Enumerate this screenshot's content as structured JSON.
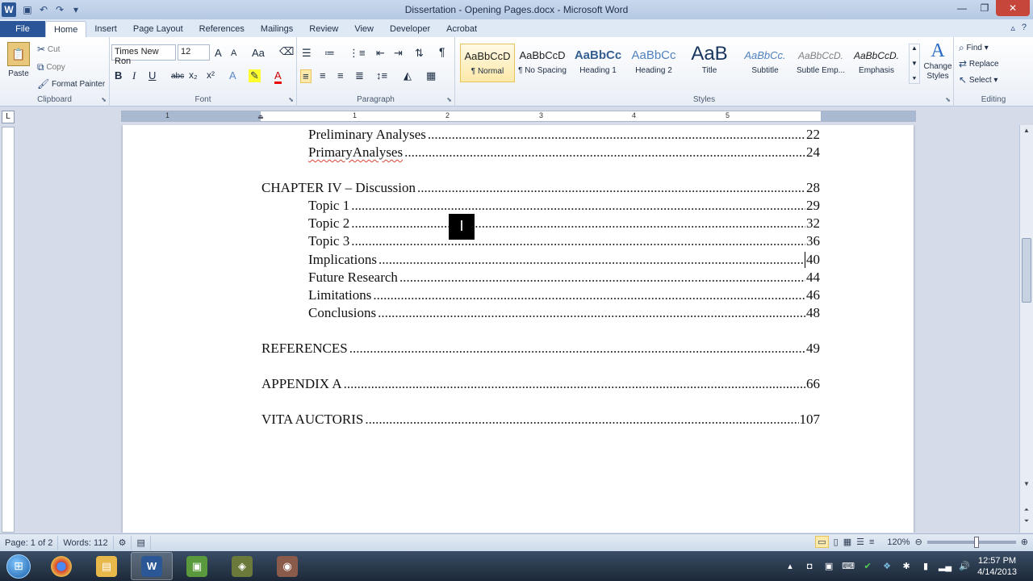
{
  "window": {
    "title": "Dissertation - Opening Pages.docx - Microsoft Word",
    "logo": "W",
    "minimize": "—",
    "maximize": "❐",
    "close": "✕"
  },
  "tabs": [
    {
      "label": "File"
    },
    {
      "label": "Home"
    },
    {
      "label": "Insert"
    },
    {
      "label": "Page Layout"
    },
    {
      "label": "References"
    },
    {
      "label": "Mailings"
    },
    {
      "label": "Review"
    },
    {
      "label": "View"
    },
    {
      "label": "Developer"
    },
    {
      "label": "Acrobat"
    }
  ],
  "ribbon": {
    "clipboard": {
      "paste": "Paste",
      "cut": "Cut",
      "copy": "Copy",
      "format_painter": "Format Painter",
      "label": "Clipboard"
    },
    "font": {
      "family": "Times New Ron",
      "size": "12",
      "label": "Font",
      "bold": "B",
      "italic": "I",
      "underline": "U",
      "strike": "abc",
      "subscript": "x₂",
      "superscript": "x²",
      "grow": "A",
      "shrink": "A",
      "case": "Aa"
    },
    "paragraph": {
      "label": "Paragraph",
      "pilcrow": "¶"
    },
    "styles": {
      "label": "Styles",
      "items": [
        {
          "sample": "AaBbCcD",
          "name": "¶ Normal"
        },
        {
          "sample": "AaBbCcD",
          "name": "¶ No Spacing"
        },
        {
          "sample": "AaBbCc",
          "name": "Heading 1"
        },
        {
          "sample": "AaBbCc",
          "name": "Heading 2"
        },
        {
          "sample": "AaB",
          "name": "Title"
        },
        {
          "sample": "AaBbCc.",
          "name": "Subtitle"
        },
        {
          "sample": "AaBbCcD.",
          "name": "Subtle Emp..."
        },
        {
          "sample": "AaBbCcD.",
          "name": "Emphasis"
        }
      ],
      "change_styles": "Change Styles"
    },
    "editing": {
      "label": "Editing",
      "find": "Find",
      "replace": "Replace",
      "select": "Select"
    }
  },
  "ruler": {
    "numbers": [
      "1",
      "1",
      "2",
      "3",
      "4",
      "5"
    ]
  },
  "document": {
    "toc": [
      {
        "label": "Preliminary Analyses",
        "page": "22",
        "level": 2
      },
      {
        "label": "PrimaryAnalyses",
        "page": "24",
        "level": 2,
        "misspelled": true
      },
      {
        "label": "CHAPTER IV – Discussion",
        "page": "28",
        "level": 1
      },
      {
        "label": "Topic 1",
        "page": "29",
        "level": 2
      },
      {
        "label": "Topic 2",
        "page": "32",
        "level": 2
      },
      {
        "label": "Topic 3",
        "page": "36",
        "level": 2
      },
      {
        "label": "Implications",
        "page": "40",
        "level": 2
      },
      {
        "label": "Future Research",
        "page": "44",
        "level": 2
      },
      {
        "label": "Limitations",
        "page": "46",
        "level": 2
      },
      {
        "label": "Conclusions",
        "page": "48",
        "level": 2
      },
      {
        "label": "REFERENCES",
        "page": "49",
        "level": 1
      },
      {
        "label": "APPENDIX A",
        "page": "66",
        "level": 1
      },
      {
        "label": "VITA AUCTORIS",
        "page": " 107",
        "level": 1
      }
    ],
    "cursor_glyph": "I"
  },
  "status": {
    "page": "Page: 1 of 2",
    "words": "Words: 112",
    "zoom": "120%"
  },
  "taskbar": {
    "time": "12:57 PM",
    "date": "4/14/2013",
    "apps": [
      {
        "name": "chrome",
        "glyph": "●",
        "color": "#d9412f"
      },
      {
        "name": "explorer",
        "glyph": "▤",
        "color": "#e8b84a"
      },
      {
        "name": "word",
        "glyph": "W",
        "color": "#2b5797"
      },
      {
        "name": "camtasia",
        "glyph": "▣",
        "color": "#5a9a3c"
      },
      {
        "name": "app5",
        "glyph": "◈",
        "color": "#6b7a3a"
      },
      {
        "name": "app6",
        "glyph": "◉",
        "color": "#8a5a4a"
      }
    ]
  }
}
